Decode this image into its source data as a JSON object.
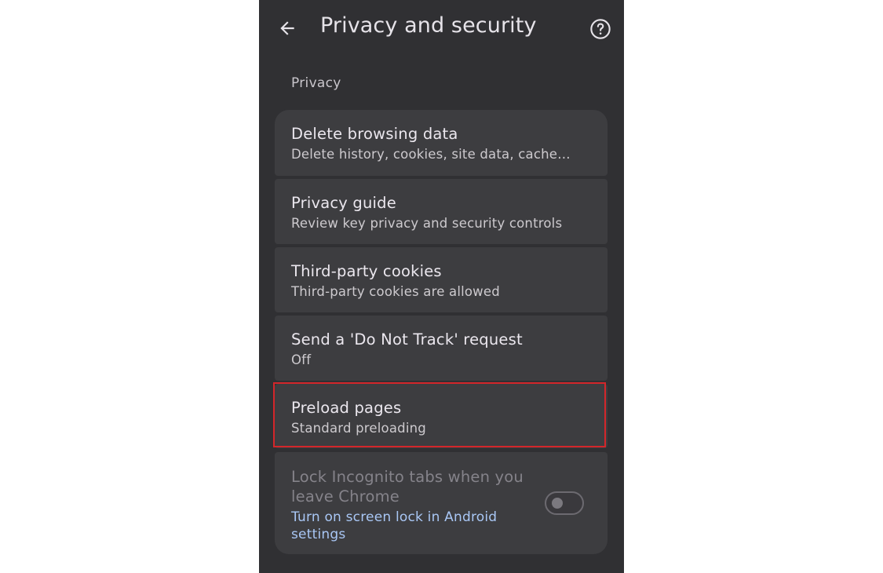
{
  "header": {
    "title": "Privacy and security"
  },
  "icons": {
    "back": "arrow-back-icon",
    "help": "help-circle-icon"
  },
  "section": {
    "label": "Privacy"
  },
  "items": [
    {
      "title": "Delete browsing data",
      "subtitle": "Delete history, cookies, site data, cache…"
    },
    {
      "title": "Privacy guide",
      "subtitle": "Review key privacy and security controls"
    },
    {
      "title": "Third-party cookies",
      "subtitle": "Third-party cookies are allowed"
    },
    {
      "title": "Send a 'Do Not Track' request",
      "subtitle": "Off"
    },
    {
      "title": "Preload pages",
      "subtitle": "Standard preloading"
    }
  ],
  "lock_incognito": {
    "title": "Lock Incognito tabs when you leave Chrome",
    "link": "Turn on screen lock in Android settings",
    "enabled": false
  },
  "colors": {
    "background": "#303033",
    "card": "#3d3d40",
    "highlight": "#d3262a",
    "link": "#a9c7f5"
  }
}
